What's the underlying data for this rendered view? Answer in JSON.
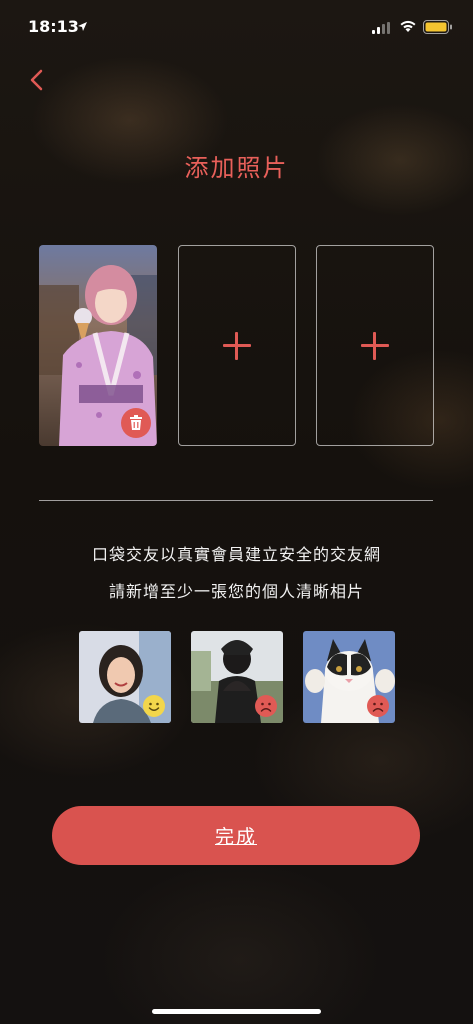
{
  "status_bar": {
    "time": "18:13",
    "icons": [
      "location-arrow-icon",
      "cellular-signal-icon",
      "wifi-icon",
      "battery-icon"
    ]
  },
  "header": {
    "back_icon": "chevron-left-icon",
    "title": "添加照片"
  },
  "photo_slots": [
    {
      "state": "filled",
      "action_icon": "trash-icon"
    },
    {
      "state": "empty",
      "action_icon": "plus-icon"
    },
    {
      "state": "empty",
      "action_icon": "plus-icon"
    }
  ],
  "info": {
    "line1": "口袋交友以真實會員建立安全的交友網",
    "line2": "請新增至少一張您的個人清晰相片"
  },
  "examples": [
    {
      "subject": "smiling woman portrait",
      "badge": "happy-face-icon",
      "badge_color": "#f2d64b"
    },
    {
      "subject": "person from behind",
      "badge": "sad-face-icon",
      "badge_color": "#e05a55"
    },
    {
      "subject": "cat",
      "badge": "sad-face-icon",
      "badge_color": "#e05a55"
    }
  ],
  "actions": {
    "done_label": "完成"
  },
  "colors": {
    "accent": "#e05a55",
    "button": "#d9534f",
    "title": "#e8605a",
    "battery": "#f4c430"
  }
}
